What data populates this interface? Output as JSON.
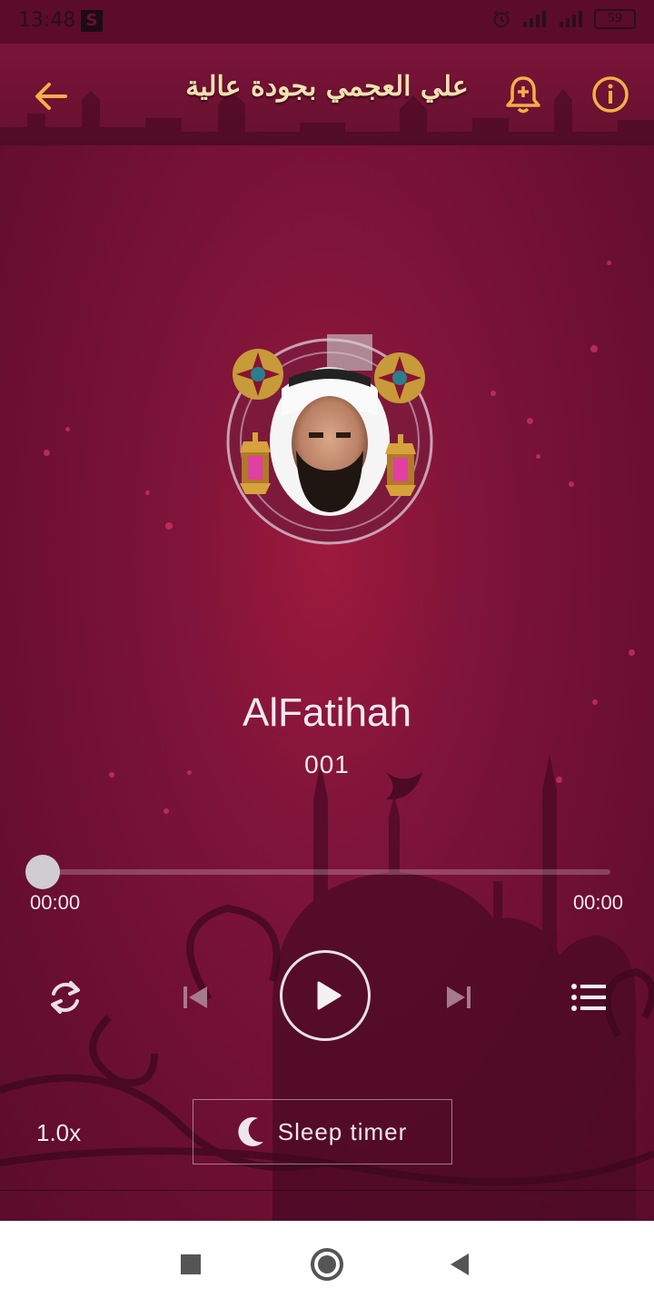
{
  "status": {
    "time": "13:48",
    "s_badge": "S",
    "battery": "59"
  },
  "header": {
    "title": "علي العجمي بجودة عالية",
    "back_icon": "arrow-left-icon",
    "bell_icon": "bell-plus-icon",
    "info_icon": "info-icon"
  },
  "track": {
    "title": "AlFatihah",
    "number": "001"
  },
  "player": {
    "current_time": "00:00",
    "total_time": "00:00",
    "progress": 0,
    "speed": "1.0x",
    "sleep_label": "Sleep timer"
  },
  "colors": {
    "accent": "#f2b04a",
    "background": "#6d0f33",
    "text": "#f4e9ee"
  },
  "navbar": {
    "icons": [
      "square-recents-icon",
      "circle-home-icon",
      "triangle-back-icon"
    ]
  }
}
